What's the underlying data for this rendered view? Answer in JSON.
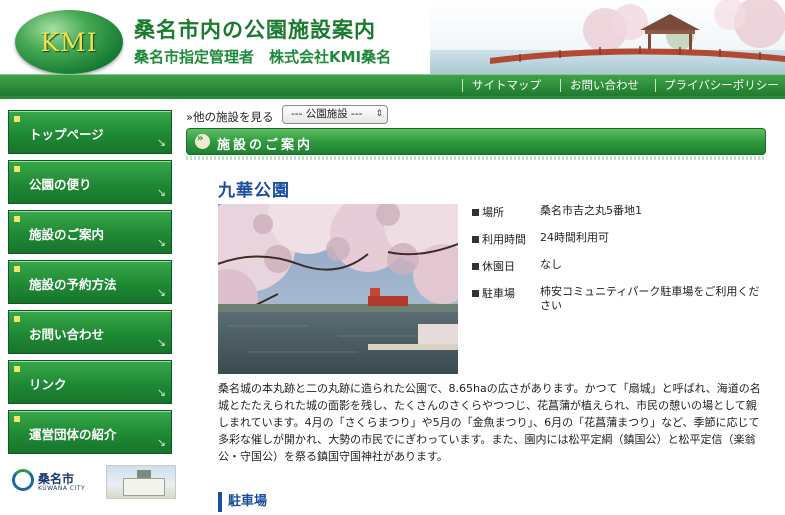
{
  "header": {
    "logo_text": "KMI",
    "title": "桑名市内の公園施設案内",
    "subtitle": "桑名市指定管理者　株式会社KMI桑名",
    "nav": [
      {
        "label": "サイトマップ"
      },
      {
        "label": "お問い合わせ"
      },
      {
        "label": "プライバシーポリシー"
      }
    ]
  },
  "sidebar": {
    "items": [
      {
        "label": "トップページ"
      },
      {
        "label": "公園の便り"
      },
      {
        "label": "施設のご案内"
      },
      {
        "label": "施設の予約方法"
      },
      {
        "label": "お問い合わせ"
      },
      {
        "label": "リンク"
      },
      {
        "label": "運営団体の紹介"
      }
    ],
    "city": {
      "name": "桑名市",
      "name_en": "KUWANA CITY"
    }
  },
  "main": {
    "other_label": "»他の施設を見る",
    "select_value": "--- 公園施設 ---",
    "section_title": "施設のご案内",
    "park_title": "九華公園",
    "info": [
      {
        "key": "場所",
        "value": "桑名市吉之丸5番地1"
      },
      {
        "key": "利用時間",
        "value": "24時間利用可"
      },
      {
        "key": "休園日",
        "value": "なし"
      },
      {
        "key": "駐車場",
        "value": "柿安コミュニティパーク駐車場をご利用ください"
      }
    ],
    "description": "桑名城の本丸跡と二の丸跡に造られた公園で、8.65haの広さがあります。かつて「扇城」と呼ばれ、海道の名城とたたえられた城の面影を残し、たくさんのさくらやつつじ、花菖蒲が植えられ、市民の憩いの場として親しまれています。4月の「さくらまつり」や5月の「金魚まつり」、6月の「花菖蒲まつり」など、季節に応じて多彩な催しが開かれ、大勢の市民でにぎわっています。また、園内には松平定綱（鎮国公）と松平定信（楽翁公・守国公）を祭る鎮国守国神社があります。",
    "parking_heading": "駐車場"
  },
  "colors": {
    "brand_green": "#1f8a35",
    "title_green": "#1a7a2d",
    "heading_blue": "#1a4fa0"
  },
  "icons": {
    "section": "arrow-circle-icon",
    "sidebar_button": "corner-arrow-icon",
    "select": "updown-arrows-icon"
  }
}
